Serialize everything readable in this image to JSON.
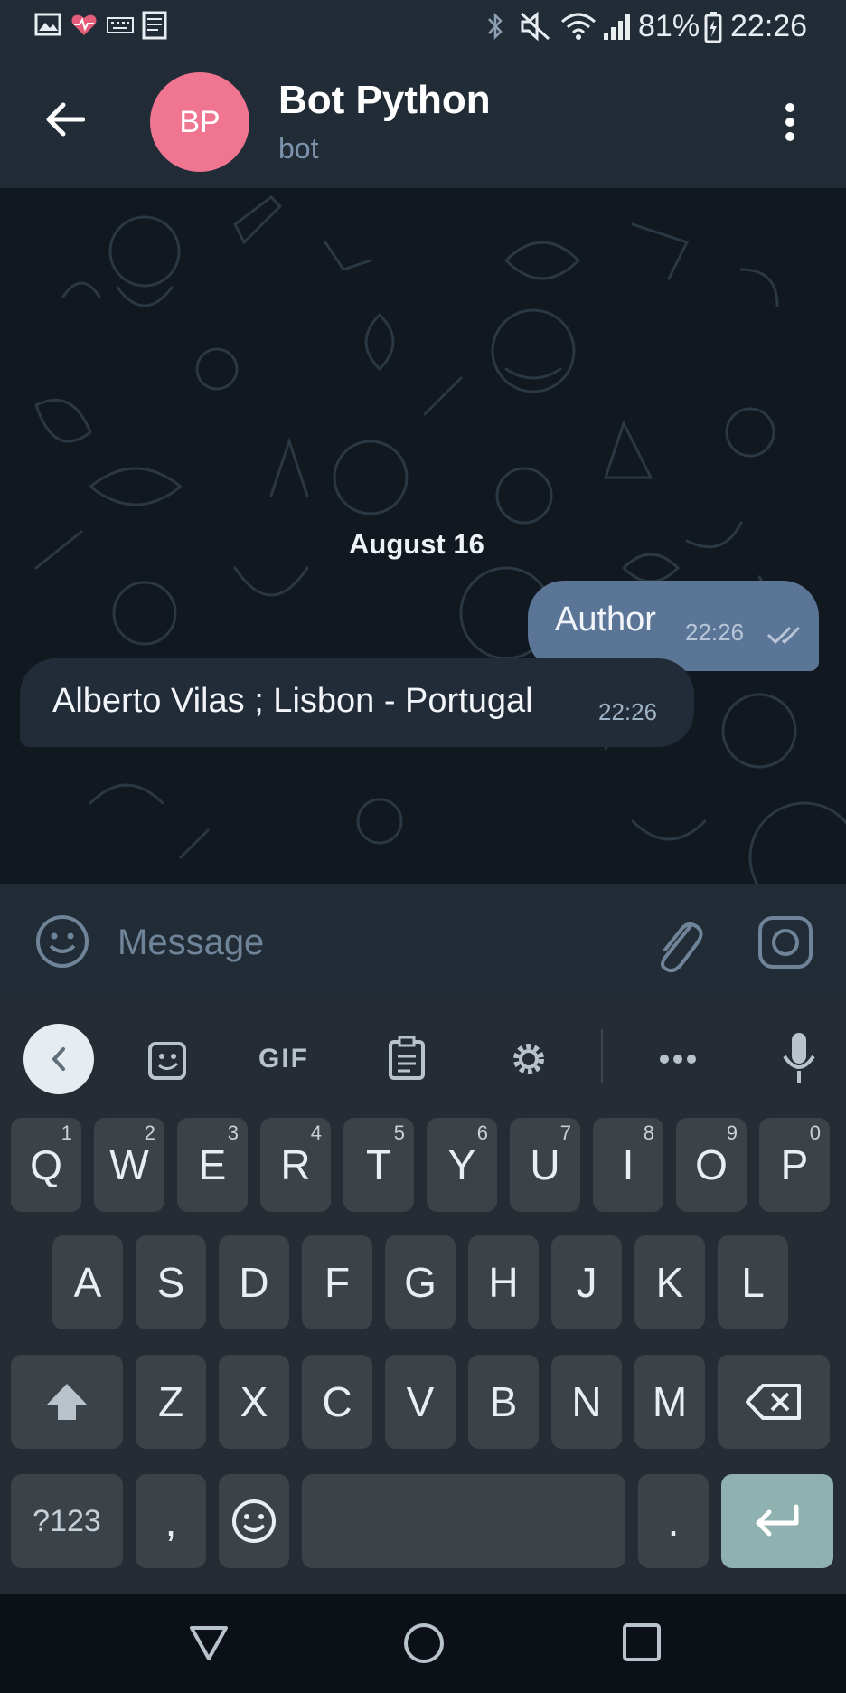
{
  "status_bar": {
    "battery": "81%",
    "time": "22:26"
  },
  "header": {
    "back_icon": "arrow-left-icon",
    "avatar_initials": "BP",
    "title": "Bot Python",
    "subtitle": "bot",
    "menu_icon": "more-vertical-icon"
  },
  "chat": {
    "date_label": "August 16",
    "messages": [
      {
        "direction": "out",
        "text": "Author",
        "time": "22:26",
        "status": "read"
      },
      {
        "direction": "in",
        "text": "Alberto Vilas ; Lisbon - Portugal",
        "time": "22:26"
      }
    ]
  },
  "composer": {
    "placeholder": "Message",
    "emoji_icon": "smile-icon",
    "attach_icon": "paperclip-icon",
    "camera_icon": "camera-icon"
  },
  "keyboard": {
    "toolbar": {
      "gif_label": "GIF"
    },
    "row1": [
      {
        "label": "Q",
        "hint": "1"
      },
      {
        "label": "W",
        "hint": "2"
      },
      {
        "label": "E",
        "hint": "3"
      },
      {
        "label": "R",
        "hint": "4"
      },
      {
        "label": "T",
        "hint": "5"
      },
      {
        "label": "Y",
        "hint": "6"
      },
      {
        "label": "U",
        "hint": "7"
      },
      {
        "label": "I",
        "hint": "8"
      },
      {
        "label": "O",
        "hint": "9"
      },
      {
        "label": "P",
        "hint": "0"
      }
    ],
    "row2": [
      "A",
      "S",
      "D",
      "F",
      "G",
      "H",
      "J",
      "K",
      "L"
    ],
    "row3": [
      "Z",
      "X",
      "C",
      "V",
      "B",
      "N",
      "M"
    ],
    "symbols_label": "?123",
    "comma_label": ",",
    "period_label": "."
  }
}
